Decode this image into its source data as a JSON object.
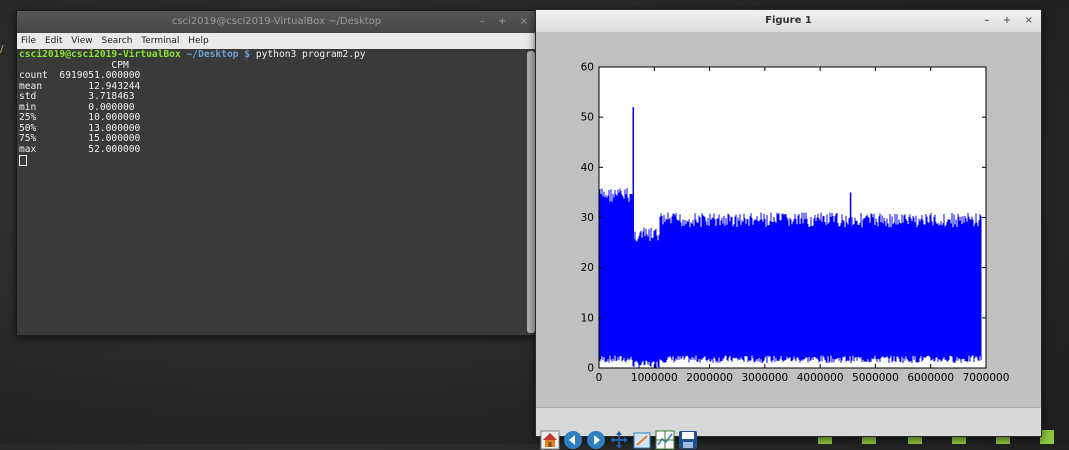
{
  "terminal": {
    "title": "csci2019@csci2019-VirtualBox ~/Desktop",
    "wm": {
      "minimize": "–",
      "maximize": "+",
      "close": "×"
    },
    "menu": [
      "File",
      "Edit",
      "View",
      "Search",
      "Terminal",
      "Help"
    ],
    "prompt_user": "csci2019@csci2019-VirtualBox",
    "prompt_path": "~/Desktop $",
    "command": "python3 program2.py",
    "output": [
      "                CPM",
      "count  6919051.000000",
      "mean        12.943244",
      "std         3.718463",
      "min         0.000000",
      "25%         10.000000",
      "50%         13.000000",
      "75%         15.000000",
      "max         52.000000"
    ]
  },
  "figure": {
    "title": "Figure 1",
    "wm": {
      "minimize": "–",
      "maximize": "+",
      "close": "×"
    },
    "toolbar": [
      "home-icon",
      "back-icon",
      "forward-icon",
      "pan-icon",
      "zoom-icon",
      "subplots-icon",
      "save-icon"
    ]
  },
  "chart_data": {
    "type": "line",
    "series_color": "#0000ff",
    "xlim": [
      0,
      7000000
    ],
    "ylim": [
      0,
      60
    ],
    "xticks": [
      0,
      1000000,
      2000000,
      3000000,
      4000000,
      5000000,
      6000000,
      7000000
    ],
    "xtick_labels": [
      "0",
      "1000000",
      "2000000",
      "3000000",
      "4000000",
      "5000000",
      "6000000",
      "7000000"
    ],
    "yticks": [
      0,
      10,
      20,
      30,
      40,
      50,
      60
    ],
    "ytick_labels": [
      "0",
      "10",
      "20",
      "30",
      "40",
      "50",
      "60"
    ],
    "x_max": 6919051,
    "band_segments": [
      {
        "x": [
          0,
          600000
        ],
        "low": 1,
        "high": 36
      },
      {
        "x": [
          600000,
          1100000
        ],
        "low": 0,
        "high": 28
      },
      {
        "x": [
          1100000,
          6919051
        ],
        "low": 1,
        "high": 31
      }
    ],
    "spikes": [
      {
        "x": 620000,
        "y": 52
      },
      {
        "x": 4550000,
        "y": 35
      }
    ]
  }
}
